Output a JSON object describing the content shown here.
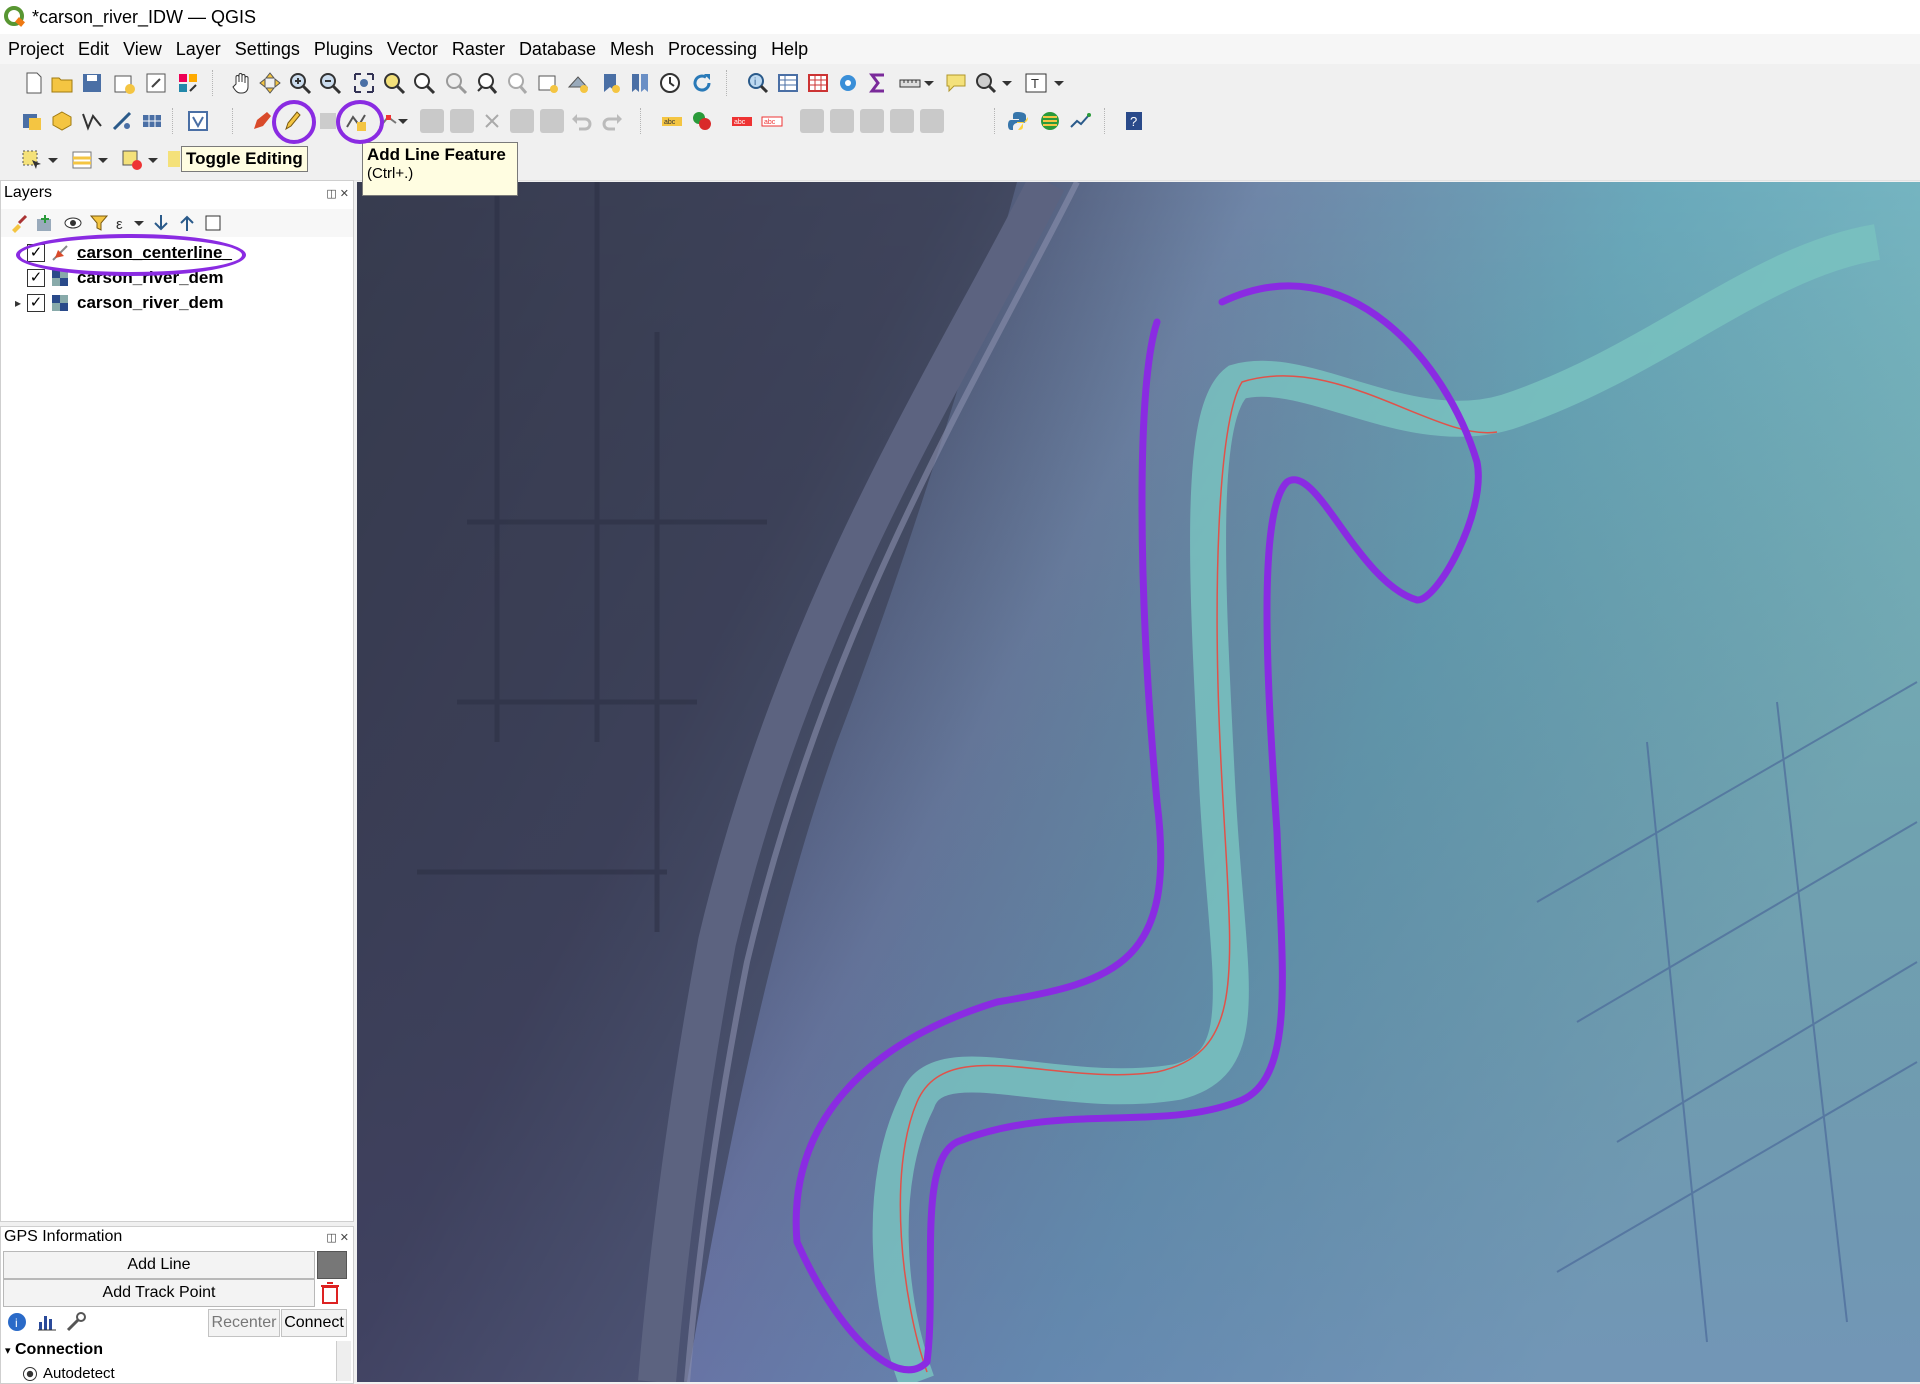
{
  "window": {
    "title": "*carson_river_IDW — QGIS"
  },
  "menu": [
    "Project",
    "Edit",
    "View",
    "Layer",
    "Settings",
    "Plugins",
    "Vector",
    "Raster",
    "Database",
    "Mesh",
    "Processing",
    "Help"
  ],
  "tooltips": {
    "toggle_editing": "Toggle Editing",
    "add_line_title": "Add Line Feature",
    "add_line_shortcut": "(Ctrl+.)"
  },
  "layers_panel": {
    "title": "Layers",
    "layers": [
      {
        "name": "carson_centerline_",
        "checked": true,
        "type": "line"
      },
      {
        "name": "carson_river_dem",
        "checked": true,
        "type": "raster"
      },
      {
        "name": "carson_river_dem",
        "checked": true,
        "type": "raster",
        "expandable": true
      }
    ]
  },
  "gps_panel": {
    "title": "GPS Information",
    "add_line": "Add Line",
    "add_track_point": "Add Track Point",
    "recenter": "Recenter",
    "connect": "Connect",
    "connection_header": "Connection",
    "autodetect": "Autodetect"
  },
  "colors": {
    "annotation": "#8a2be2",
    "centerline": "#e0524a",
    "toolbar_bg": "#f0f0f0"
  }
}
